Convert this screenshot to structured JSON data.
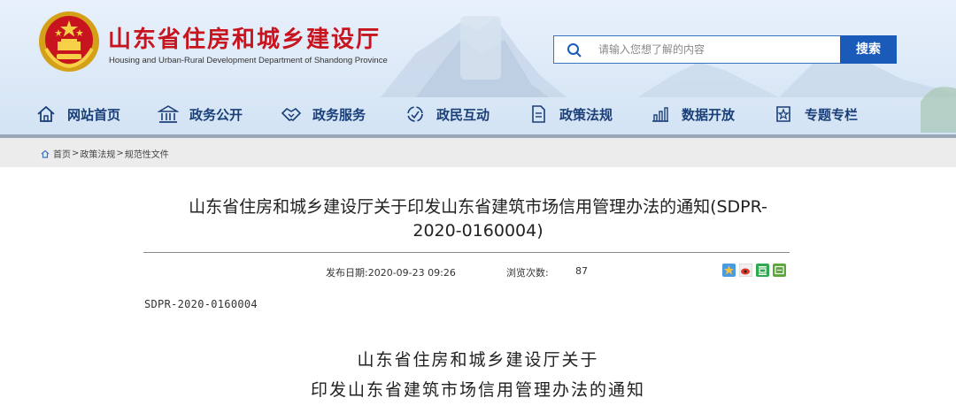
{
  "header": {
    "site_title": "山东省住房和城乡建设厅",
    "site_subtitle": "Housing and Urban-Rural Development Department of Shandong Province",
    "search_placeholder": "请输入您想了解的内容",
    "search_button": "搜索",
    "brand_color": "#c8141e",
    "accent_color": "#1a5ab8"
  },
  "nav": {
    "items": [
      {
        "label": "网站首页",
        "icon": "home-icon"
      },
      {
        "label": "政务公开",
        "icon": "building-icon"
      },
      {
        "label": "政务服务",
        "icon": "handshake-icon"
      },
      {
        "label": "政民互动",
        "icon": "interaction-icon"
      },
      {
        "label": "政策法规",
        "icon": "document-icon"
      },
      {
        "label": "数据开放",
        "icon": "chart-icon"
      },
      {
        "label": "专题专栏",
        "icon": "topic-icon"
      }
    ]
  },
  "breadcrumb": {
    "items": [
      "首页",
      "政策法规",
      "规范性文件"
    ],
    "separator": ">"
  },
  "article": {
    "title_line1": "山东省住房和城乡建设厅关于印发山东省建筑市场信用管理办法的通知(SDPR-",
    "title_line2": "2020-0160004)",
    "publish_label": "发布日期:2020-09-23 09:26",
    "views_label": "浏览次数:",
    "views_count": "87",
    "doc_code": "SDPR-2020-0160004",
    "heading_line1": "山东省住房和城乡建设厅关于",
    "heading_line2": "印发山东省建筑市场信用管理办法的通知"
  }
}
